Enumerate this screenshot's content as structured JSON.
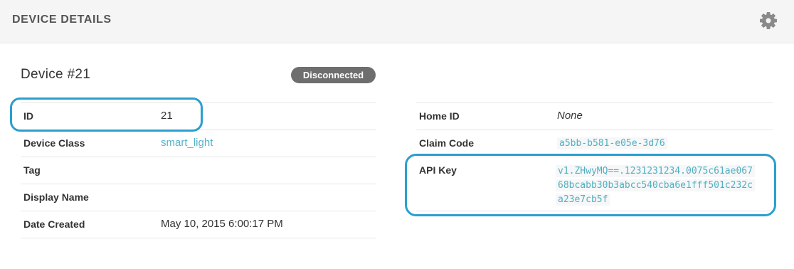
{
  "header": {
    "title": "DEVICE DETAILS",
    "settings_icon": "gear-icon"
  },
  "device": {
    "title": "Device #21",
    "status": "Disconnected"
  },
  "left_table": [
    {
      "label": "ID",
      "value": "21"
    },
    {
      "label": "Device Class",
      "value": "smart_light"
    },
    {
      "label": "Tag",
      "value": ""
    },
    {
      "label": "Display Name",
      "value": ""
    },
    {
      "label": "Date Created",
      "value": "May 10, 2015 6:00:17 PM"
    }
  ],
  "right_table": [
    {
      "label": "Home ID",
      "value": "None"
    },
    {
      "label": "Claim Code",
      "value": "a5bb-b581-e05e-3d76"
    },
    {
      "label": "API Key",
      "value_lines": [
        "v1.ZHwyMQ==.1231231234.0075c61ae067",
        "68bcabb30b3abcc540cba6e1fff501c232c",
        "a23e7cb5f"
      ]
    }
  ],
  "colors": {
    "accent": "#54b4c6",
    "highlight": "#2a9fcf",
    "badge": "#6e6e6e"
  }
}
